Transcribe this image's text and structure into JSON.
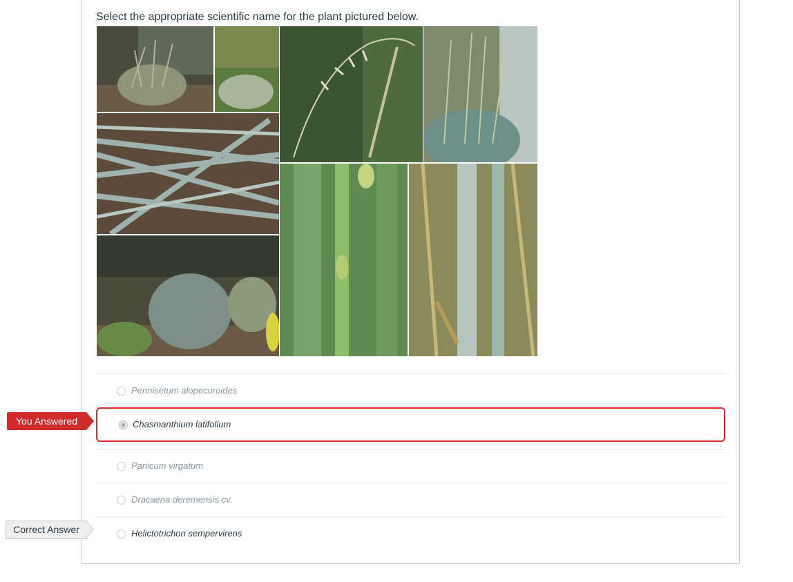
{
  "question": {
    "prompt": "Select the appropriate scientific name for the plant pictured below."
  },
  "image": {
    "description_icon": "plant-photo-collage"
  },
  "flags": {
    "you_answered": "You Answered",
    "correct_answer": "Correct Answer"
  },
  "answers": [
    {
      "label": "Pennisetum alopecuroides",
      "state": "unselected"
    },
    {
      "label": "Chasmanthium latifolium",
      "state": "selected-wrong"
    },
    {
      "label": "Panicum virgatum",
      "state": "unselected"
    },
    {
      "label": "Dracaena deremensis cv.",
      "state": "unselected"
    },
    {
      "label": "Helictotrichon sempervirens",
      "state": "correct"
    }
  ],
  "colors": {
    "wrong": "#d02a2a",
    "text": "#2d3b45",
    "muted": "#8a959c"
  }
}
